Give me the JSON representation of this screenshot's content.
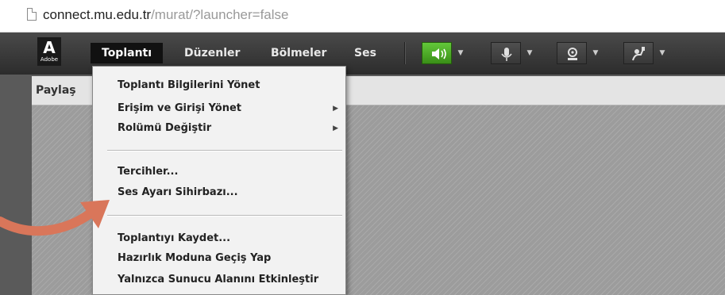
{
  "browser": {
    "url_host": "connect.mu.edu.tr",
    "url_path": "/murat/?launcher=false"
  },
  "app": {
    "logo_text": "Adobe",
    "menus": [
      "Toplantı",
      "Düzenler",
      "Bölmeler",
      "Ses"
    ],
    "active_menu": "Toplantı",
    "toolbar_icons": [
      "speaker-icon",
      "microphone-icon",
      "webcam-icon",
      "raise-hand-icon"
    ],
    "accent_color": "#4caf2a"
  },
  "pod": {
    "title": "Paylaş"
  },
  "dropdown": {
    "group1": [
      "Toplantı Bilgilerini Yönet",
      "Erişim ve Girişi Yönet",
      "Rolümü Değiştir"
    ],
    "group2": [
      "Tercihler...",
      "Ses Ayarı Sihirbazı..."
    ],
    "group3": [
      "Toplantıyı Kaydet...",
      "Hazırlık Moduna Geçiş Yap",
      "Yalnızca Sunucu Alanını Etkinleştir"
    ]
  },
  "annotation": {
    "arrow_color": "#d9765a"
  }
}
